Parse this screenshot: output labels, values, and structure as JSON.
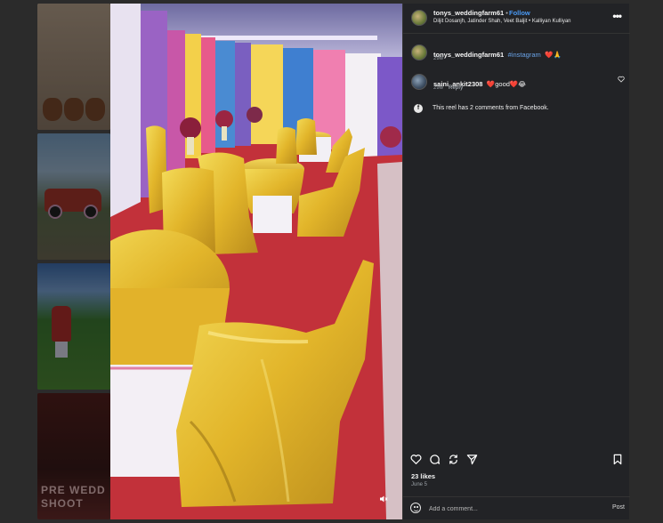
{
  "post": {
    "username": "tonys_weddingfarm61",
    "follow_label": "Follow",
    "audio_line": "Diljit Dosanjh, Jatinder Shah, Veet Baljit • Kalliyan Kulliyan",
    "more_label": "•••"
  },
  "caption": {
    "username": "tonys_weddingfarm61",
    "tag": "#instagram",
    "emoji": "❤️🙏",
    "time": "29w"
  },
  "comments": [
    {
      "username": "saini_ankit2308",
      "text": "❤️good❤️😂",
      "time": "29w",
      "reply_label": "Reply"
    }
  ],
  "facebook_note": "This reel has 2 comments from Facebook.",
  "likes": "23 likes",
  "date": "June 5",
  "add_comment": {
    "placeholder": "Add a comment...",
    "post_label": "Post"
  },
  "thumbs": {
    "sign_text": "PRE WEDD SHOOT"
  },
  "colors": {
    "accent": "#4a9af5",
    "panel_bg": "#222326",
    "carpet": "#c2313a",
    "satin": "#e6c22e"
  },
  "icons": [
    "more-icon",
    "heart-icon",
    "comment-icon",
    "repost-icon",
    "share-icon",
    "bookmark-icon",
    "mute-icon",
    "facebook-icon",
    "emoji-icon"
  ]
}
